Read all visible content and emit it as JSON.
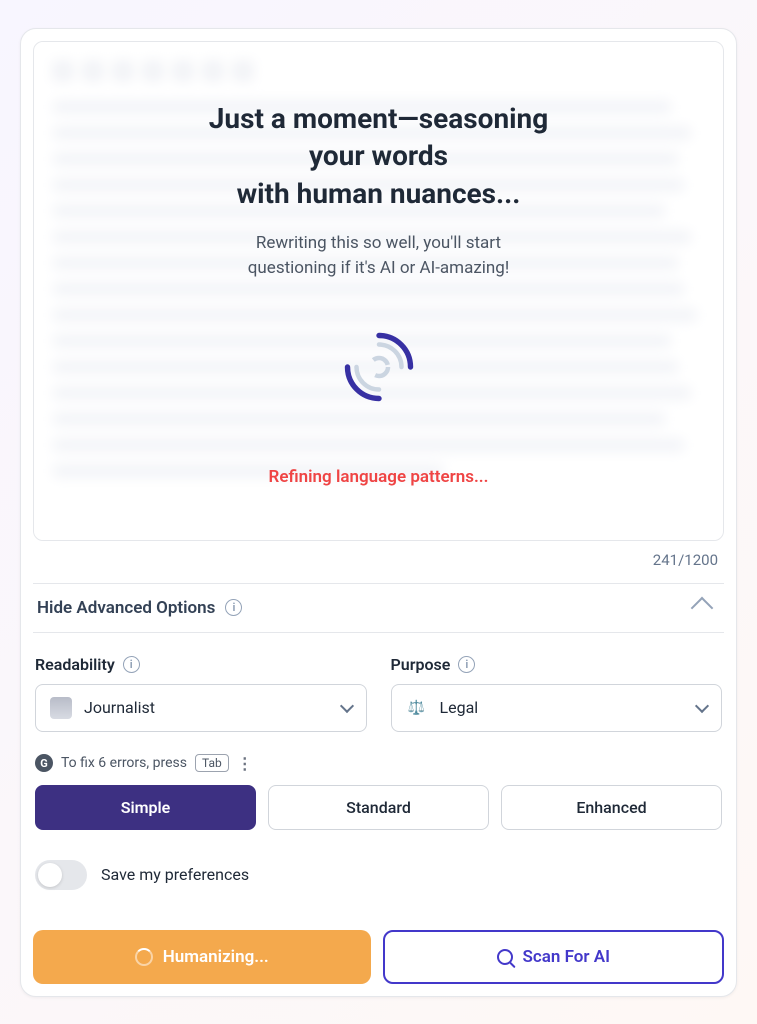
{
  "overlay": {
    "title_line1": "Just a moment—seasoning",
    "title_line2": "your words",
    "title_line3": "with human nuances...",
    "sub_line1": "Rewriting this so well, you'll start",
    "sub_line2": "questioning if it's AI or AI-amazing!",
    "status": "Refining language patterns..."
  },
  "editor": {
    "word_count": "241/1200"
  },
  "advanced": {
    "toggle_label": "Hide Advanced Options"
  },
  "readability": {
    "label": "Readability",
    "value": "Journalist"
  },
  "purpose": {
    "label": "Purpose",
    "value": "Legal"
  },
  "grammar": {
    "text": "To fix 6 errors, press",
    "key": "Tab"
  },
  "segments": {
    "simple": "Simple",
    "standard": "Standard",
    "enhanced": "Enhanced"
  },
  "preferences": {
    "save_label": "Save my preferences"
  },
  "actions": {
    "humanize": "Humanizing...",
    "scan": "Scan For AI"
  }
}
